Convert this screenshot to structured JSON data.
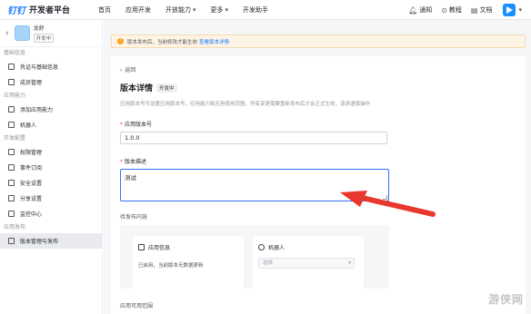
{
  "topbar": {
    "logo_mark": "钉钉",
    "logo_text": "开发者平台",
    "nav": [
      "首页",
      "应用开发",
      "开放能力",
      "更多",
      "开发助手"
    ],
    "right": {
      "notify": "通知",
      "tutorial": "教程",
      "docs": "文档"
    }
  },
  "sidebar": {
    "app_name": "龙舒",
    "app_badge": "开发中",
    "groups": [
      {
        "title": "基础信息",
        "items": [
          "凭证与基础信息",
          "成员管理"
        ]
      },
      {
        "title": "应用能力",
        "items": [
          "添加应用能力",
          "机器人"
        ]
      },
      {
        "title": "开发配置",
        "items": [
          "权限管理",
          "事件订阅",
          "安全设置",
          "分享设置",
          "监控中心"
        ]
      },
      {
        "title": "应用发布",
        "items": [
          "版本管理与发布"
        ]
      }
    ],
    "active_item": "版本管理与发布"
  },
  "notice": {
    "text": "版本发布后，当前修改才能生效",
    "link": "查看版本详情"
  },
  "main": {
    "back": "返回",
    "title": "版本详情",
    "status": "开发中",
    "description": "应用版本号可设置应用版本号，应用能力和应用使用范围，所有变更需要重新发布后才会正式生效，该请谨慎操作",
    "version_label": "应用版本号",
    "version_value": "1.0.0",
    "desc_label": "版本描述",
    "desc_value": "测试",
    "pending_label": "待发布内容",
    "cards": {
      "app_info": {
        "title": "应用信息",
        "body": "已启用，当前版本无数据更新"
      },
      "robot": {
        "title": "机器人",
        "select_placeholder": "选择"
      }
    },
    "range_label": "应用可用范围"
  },
  "watermark": "游侠网",
  "colors": {
    "brand": "#1677ff",
    "annotation": "#e8372c",
    "notice_bg": "#fdf4e6"
  }
}
